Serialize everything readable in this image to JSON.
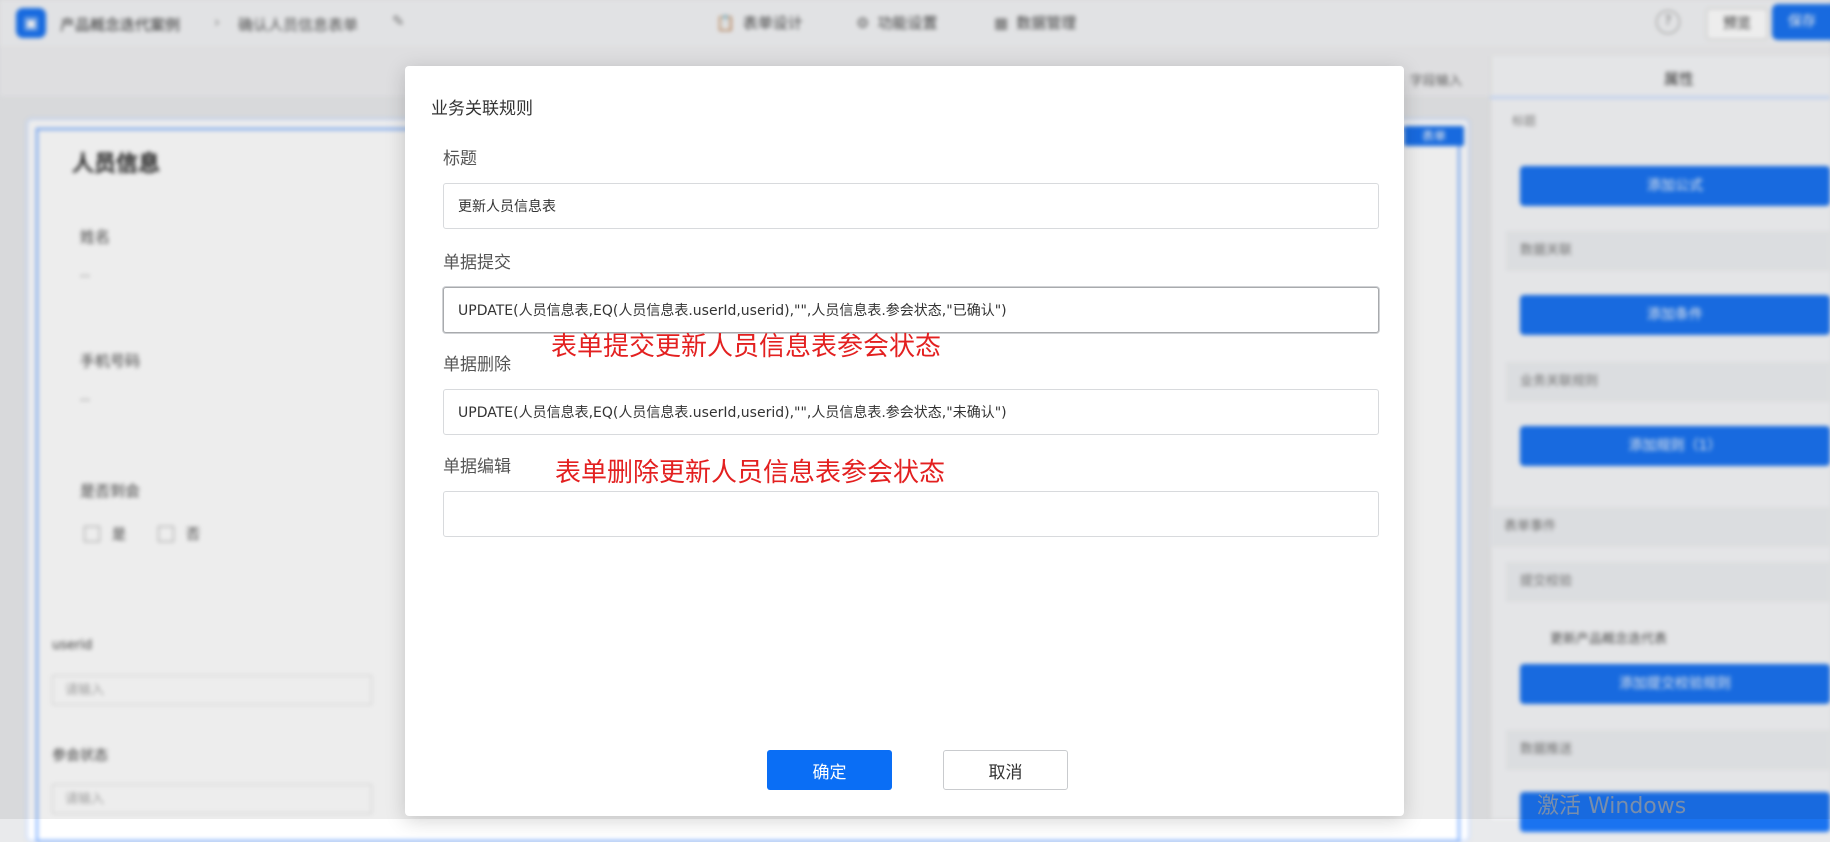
{
  "header": {
    "logo_glyph": "▣",
    "app_title": "产品概念迭代案例",
    "breadcrumb_sep": "›",
    "form_title": "确认人员信息表单",
    "nav_tabs": [
      {
        "icon": "📋",
        "label": "表单设计"
      },
      {
        "icon": "⚙",
        "label": "功能设置"
      },
      {
        "icon": "▦",
        "label": "数据管理"
      }
    ],
    "help_glyph": "?",
    "preview_label": "预览",
    "save_label": "保存"
  },
  "subbar": {
    "right_item": "字段输入"
  },
  "canvas": {
    "tag": "表单",
    "heading": "人员信息",
    "fields": [
      {
        "label": "姓名",
        "placeholder": "--"
      },
      {
        "label": "手机号码",
        "placeholder": "--"
      },
      {
        "label": "是否到会",
        "options": [
          "是",
          "否"
        ]
      }
    ],
    "lower_fields": [
      {
        "label": "userid",
        "placeholder": "请输入"
      },
      {
        "label": "参会状态",
        "placeholder": "请输入"
      }
    ]
  },
  "right_panel": {
    "tab": "属性",
    "items": [
      {
        "type": "text",
        "label": "标题"
      },
      {
        "type": "button",
        "label": "添加公式"
      },
      {
        "type": "section",
        "label": "数据关联"
      },
      {
        "type": "button",
        "label": "添加条件"
      },
      {
        "type": "section",
        "label": "业务关联规则"
      },
      {
        "type": "button",
        "label": "添加规则（1）"
      },
      {
        "type": "section",
        "label": "表单事件"
      },
      {
        "type": "section",
        "label": "提交校验"
      },
      {
        "type": "text",
        "label": "更新产品概念迭代表"
      },
      {
        "type": "button",
        "label": "添加提交校验规则"
      },
      {
        "type": "section",
        "label": "数据推送"
      }
    ]
  },
  "watermark": "激活 Windows",
  "modal": {
    "title": "业务关联规则",
    "fields": {
      "title_label": "标题",
      "title_value": "更新人员信息表",
      "submit_label": "单据提交",
      "submit_value": "UPDATE(人员信息表,EQ(人员信息表.userId,userid),\"\",人员信息表.参会状态,\"已确认\")",
      "delete_label": "单据删除",
      "delete_value": "UPDATE(人员信息表,EQ(人员信息表.userId,userid),\"\",人员信息表.参会状态,\"未确认\")",
      "edit_label": "单据编辑",
      "edit_value": ""
    },
    "annotations": {
      "submit_note": "表单提交更新人员信息表参会状态",
      "delete_note": "表单删除更新人员信息表参会状态"
    },
    "confirm_label": "确定",
    "cancel_label": "取消"
  }
}
